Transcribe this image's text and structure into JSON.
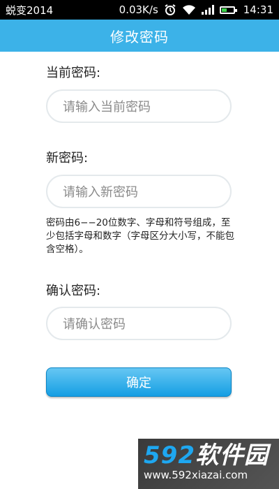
{
  "status_bar": {
    "carrier": "蜕变2014",
    "speed": "0.03K/s",
    "time": "14:31",
    "icons": [
      "alarm-icon",
      "wifi-icon",
      "signal-icon",
      "battery-icon"
    ]
  },
  "title_bar": {
    "title": "修改密码"
  },
  "form": {
    "current_label": "当前密码:",
    "current_placeholder": "请输入当前密码",
    "new_label": "新密码:",
    "new_placeholder": "请输入新密码",
    "hint": "密码由6−−20位数字、字母和符号组成，至少包括字母和数字（字母区分大小写，不能包含空格）。",
    "confirm_label": "确认密码:",
    "confirm_placeholder": "请确认密码",
    "submit_label": "确定"
  },
  "watermark": {
    "logo_num": "592",
    "logo_text": "软件园",
    "url": "www.592xiazai.com"
  },
  "colors": {
    "title_bar": "#3cb2e8",
    "button": "#159ee3"
  }
}
